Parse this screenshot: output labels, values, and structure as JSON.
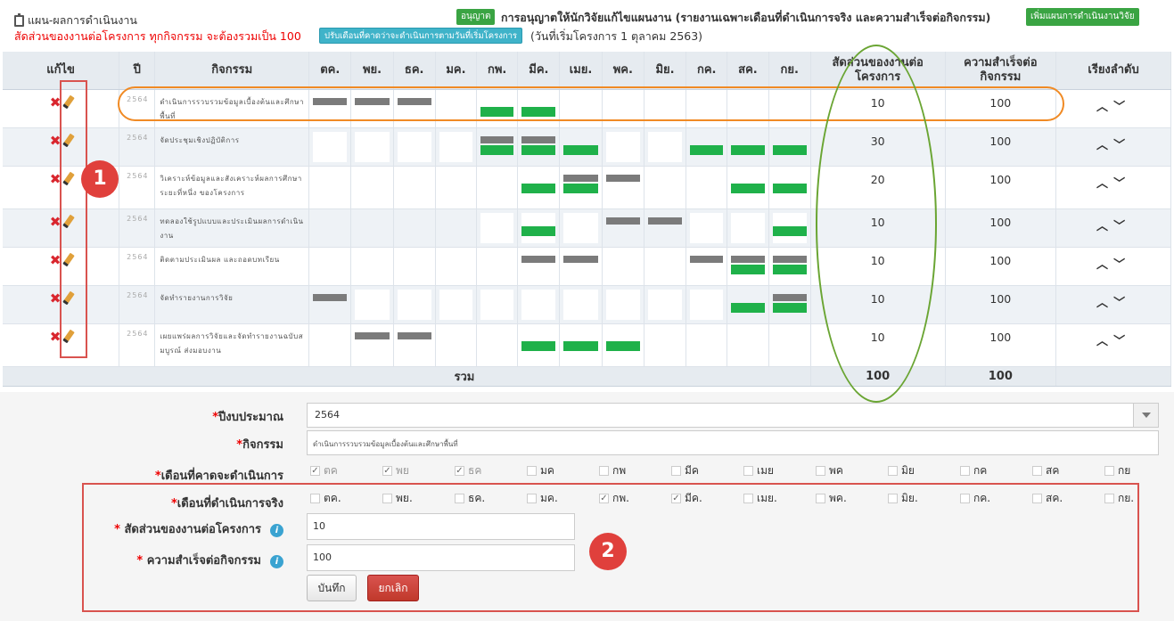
{
  "header": {
    "title": "แผน-ผลการดำเนินงาน",
    "warning": "สัดส่วนของงานต่อโครงการ ทุกกิจกรรม จะต้องรวมเป็น 100",
    "adjust_button": "ปรับเดือนที่คาดว่าจะดำเนินการตามวันที่เริ่มโครงการ",
    "start_date": "(วันที่เริ่มโครงการ 1 ตุลาคม 2563)",
    "permission_badge": "อนุญาต",
    "permission_text": "การอนุญาตให้นักวิจัยแก้ไขแผนงาน (รายงานเฉพาะเดือนที่ดำเนินการจริง และความสำเร็จต่อกิจกรรม)",
    "add_plan_button": "เพิ่มแผนการดำเนินงานวิจัย"
  },
  "table": {
    "columns": {
      "edit": "แก้ไข",
      "year": "ปี",
      "activity": "กิจกรรม",
      "months": [
        "ตค.",
        "พย.",
        "ธค.",
        "มค.",
        "กพ.",
        "มีค.",
        "เมย.",
        "พค.",
        "มิย.",
        "กค.",
        "สค.",
        "กย."
      ],
      "share": "สัดส่วนของงานต่อโครงการ",
      "success": "ความสำเร็จต่อกิจกรรม",
      "order": "เรียงลำดับ"
    },
    "rows": [
      {
        "year": "2564",
        "activity": "ดำเนินการรวบรวมข้อมูลเบื้องต้นและศึกษาพื้นที่",
        "plan": [
          1,
          1,
          1,
          0,
          0,
          0,
          0,
          0,
          0,
          0,
          0,
          0
        ],
        "actual": [
          0,
          0,
          0,
          0,
          1,
          1,
          0,
          0,
          0,
          0,
          0,
          0
        ],
        "box": [
          0,
          0,
          0,
          0,
          0,
          0,
          0,
          0,
          0,
          0,
          0,
          0
        ],
        "share": "10",
        "success": "100"
      },
      {
        "year": "2564",
        "activity": "จัดประชุมเชิงปฏิบัติการ",
        "plan": [
          0,
          0,
          0,
          0,
          1,
          1,
          0,
          0,
          0,
          0,
          0,
          0
        ],
        "actual": [
          0,
          0,
          0,
          0,
          1,
          1,
          1,
          0,
          0,
          1,
          1,
          1
        ],
        "box": [
          1,
          1,
          1,
          1,
          0,
          0,
          0,
          1,
          1,
          0,
          0,
          0
        ],
        "share": "30",
        "success": "100"
      },
      {
        "year": "2564",
        "activity": "วิเคราะห์ข้อมูลและสังเคราะห์ผลการศึกษา ระยะที่หนึ่ง ของโครงการ",
        "plan": [
          0,
          0,
          0,
          0,
          0,
          0,
          1,
          1,
          0,
          0,
          0,
          0
        ],
        "actual": [
          0,
          0,
          0,
          0,
          0,
          1,
          1,
          0,
          0,
          0,
          1,
          1
        ],
        "box": [
          0,
          0,
          0,
          0,
          0,
          0,
          0,
          0,
          0,
          0,
          0,
          0
        ],
        "share": "20",
        "success": "100"
      },
      {
        "year": "2564",
        "activity": "ทดลองใช้รูปแบบและประเมินผลการดำเนินงาน",
        "plan": [
          0,
          0,
          0,
          0,
          0,
          0,
          0,
          1,
          1,
          0,
          0,
          0
        ],
        "actual": [
          0,
          0,
          0,
          0,
          0,
          1,
          0,
          0,
          0,
          0,
          0,
          1
        ],
        "box": [
          0,
          0,
          0,
          0,
          1,
          1,
          1,
          0,
          0,
          1,
          1,
          1
        ],
        "share": "10",
        "success": "100"
      },
      {
        "year": "2564",
        "activity": "ติดตามประเมินผล และถอดบทเรียน",
        "plan": [
          0,
          0,
          0,
          0,
          0,
          1,
          1,
          0,
          0,
          1,
          1,
          1
        ],
        "actual": [
          0,
          0,
          0,
          0,
          0,
          0,
          0,
          0,
          0,
          0,
          1,
          1
        ],
        "box": [
          0,
          0,
          0,
          0,
          0,
          0,
          0,
          0,
          0,
          0,
          0,
          0
        ],
        "share": "10",
        "success": "100"
      },
      {
        "year": "2564",
        "activity": "จัดทำรายงานการวิจัย",
        "plan": [
          1,
          0,
          0,
          0,
          0,
          0,
          0,
          0,
          0,
          0,
          0,
          1
        ],
        "actual": [
          0,
          0,
          0,
          0,
          0,
          0,
          0,
          0,
          0,
          0,
          1,
          1
        ],
        "box": [
          0,
          1,
          1,
          1,
          1,
          1,
          1,
          1,
          1,
          1,
          0,
          0
        ],
        "share": "10",
        "success": "100"
      },
      {
        "year": "2564",
        "activity": "เผยแพร่ผลการวิจัยและจัดทำรายงานฉบับสมบูรณ์ ส่งมอบงาน",
        "plan": [
          0,
          1,
          1,
          0,
          0,
          0,
          0,
          0,
          0,
          0,
          0,
          0
        ],
        "actual": [
          0,
          0,
          0,
          0,
          0,
          1,
          1,
          1,
          0,
          0,
          0,
          0
        ],
        "box": [
          0,
          0,
          0,
          0,
          0,
          0,
          0,
          0,
          0,
          0,
          0,
          0
        ],
        "share": "10",
        "success": "100"
      }
    ],
    "total_label": "รวม",
    "total_share": "100",
    "total_success": "100"
  },
  "form": {
    "budget_year_label": "ปีงบประมาณ",
    "budget_year_value": "2564",
    "activity_label": "กิจกรรม",
    "activity_value": "ดำเนินการรวบรวมข้อมูลเบื้องต้นและศึกษาพื้นที่",
    "expected_months_label": "เดือนที่คาดจะดำเนินการ",
    "expected_months": [
      {
        "label": "ตค",
        "checked": true
      },
      {
        "label": "พย",
        "checked": true
      },
      {
        "label": "ธค",
        "checked": true
      },
      {
        "label": "มค",
        "checked": false
      },
      {
        "label": "กพ",
        "checked": false
      },
      {
        "label": "มีค",
        "checked": false
      },
      {
        "label": "เมย",
        "checked": false
      },
      {
        "label": "พค",
        "checked": false
      },
      {
        "label": "มิย",
        "checked": false
      },
      {
        "label": "กค",
        "checked": false
      },
      {
        "label": "สค",
        "checked": false
      },
      {
        "label": "กย",
        "checked": false
      }
    ],
    "actual_months_label": "เดือนที่ดำเนินการจริง",
    "actual_months": [
      {
        "label": "ตค.",
        "checked": false
      },
      {
        "label": "พย.",
        "checked": false
      },
      {
        "label": "ธค.",
        "checked": false
      },
      {
        "label": "มค.",
        "checked": false
      },
      {
        "label": "กพ.",
        "checked": true
      },
      {
        "label": "มีค.",
        "checked": true
      },
      {
        "label": "เมย.",
        "checked": false
      },
      {
        "label": "พค.",
        "checked": false
      },
      {
        "label": "มิย.",
        "checked": false
      },
      {
        "label": "กค.",
        "checked": false
      },
      {
        "label": "สค.",
        "checked": false
      },
      {
        "label": "กย.",
        "checked": false
      }
    ],
    "share_label": "สัดส่วนของงานต่อโครงการ",
    "share_value": "10",
    "success_label": "ความสำเร็จต่อกิจกรรม",
    "success_value": "100",
    "save_button": "บันทึก",
    "cancel_button": "ยกเลิก"
  },
  "annotations": {
    "badge_1": "1",
    "badge_2": "2"
  },
  "colors": {
    "plan_bar": "#7b7b7b",
    "actual_bar": "#1fb14a",
    "warning_text": "#ee0000",
    "annotation_red": "#d9534f",
    "annotation_orange": "#f08a24",
    "annotation_green": "#6aa533"
  }
}
